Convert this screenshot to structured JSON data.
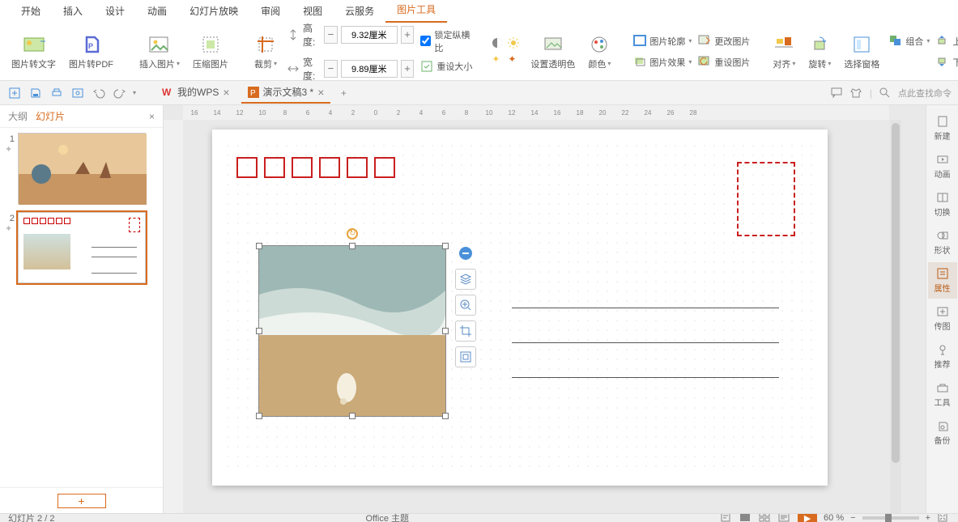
{
  "tabs": {
    "start": "开始",
    "insert": "插入",
    "design": "设计",
    "anim": "动画",
    "show": "幻灯片放映",
    "review": "审阅",
    "view": "视图",
    "cloud": "云服务",
    "picture": "图片工具"
  },
  "ribbon": {
    "toText": "图片转文字",
    "toPdf": "图片转PDF",
    "insertPic": "插入图片",
    "compress": "压缩图片",
    "crop": "裁剪",
    "height": "高度:",
    "width": "宽度:",
    "h_val": "9.32厘米",
    "w_val": "9.89厘米",
    "lock": "锁定纵横比",
    "resetSize": "重设大小",
    "setTransparent": "设置透明色",
    "color": "颜色",
    "outline": "图片轮廓",
    "effect": "图片效果",
    "changePic": "更改图片",
    "resetPic": "重设图片",
    "align": "对齐",
    "rotate": "旋转",
    "selPane": "选择窗格",
    "group": "组合",
    "moveUp": "上移",
    "moveDown": "下移"
  },
  "docbar": {
    "wps": "我的WPS",
    "doc": "演示文稿3 *",
    "search": "点此查找命令"
  },
  "slidePanel": {
    "outline": "大纲",
    "slides": "幻灯片"
  },
  "ruler": [
    "16",
    "14",
    "12",
    "10",
    "8",
    "6",
    "4",
    "2",
    "0",
    "2",
    "4",
    "6",
    "8",
    "10",
    "12",
    "14",
    "16",
    "18",
    "20",
    "22",
    "24",
    "26",
    "28"
  ],
  "rail": {
    "new": "新建",
    "anim": "动画",
    "trans": "切换",
    "shape": "形状",
    "prop": "属性",
    "img": "传图",
    "rec": "推荐",
    "tool": "工具",
    "backup": "备份"
  },
  "status": {
    "slide": "幻灯片 2 / 2",
    "theme": "Office 主题",
    "zoom": "60 %"
  }
}
